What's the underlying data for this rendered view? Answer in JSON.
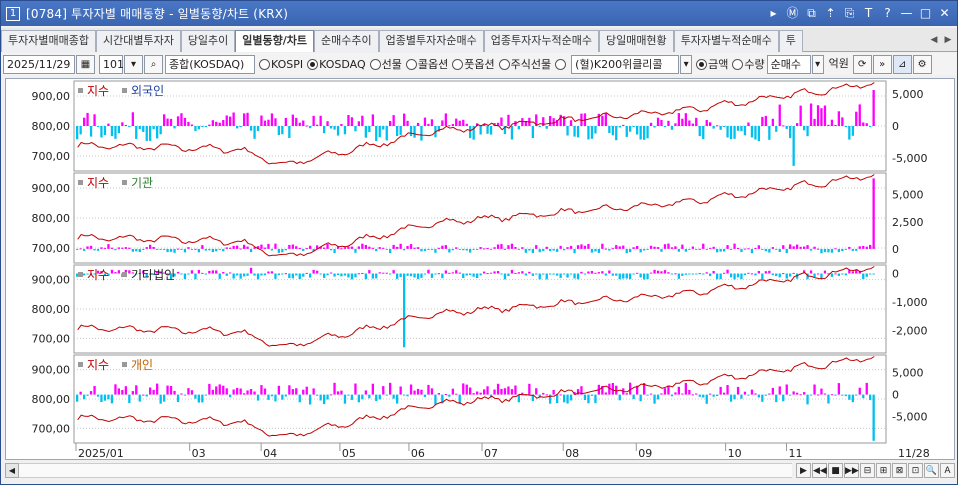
{
  "window": {
    "screen_no": "1",
    "title": "[0784] 투자자별 매매동향 - 일별동향/차트 (KRX)"
  },
  "title_buttons": [
    "▸",
    "Ⓜ",
    "⧉",
    "⇡",
    "⎘",
    "T",
    "?",
    "—",
    "□",
    "✕"
  ],
  "tabs": [
    {
      "label": "투자자별매매종합",
      "active": false
    },
    {
      "label": "시간대별투자자",
      "active": false
    },
    {
      "label": "당일추이",
      "active": false
    },
    {
      "label": "일별동향/차트",
      "active": true
    },
    {
      "label": "순매수추이",
      "active": false
    },
    {
      "label": "업종별투자자순매수",
      "active": false
    },
    {
      "label": "업종투자자누적순매수",
      "active": false
    },
    {
      "label": "당일매매현황",
      "active": false
    },
    {
      "label": "투자자별누적순매수",
      "active": false
    },
    {
      "label": "투",
      "active": false
    }
  ],
  "toolbar": {
    "date": "2025/11/29",
    "code": "101",
    "market_name": "종합(KOSDAQ)",
    "radios": [
      {
        "label": "KOSPI",
        "on": false
      },
      {
        "label": "KOSDAQ",
        "on": true
      },
      {
        "label": "선물",
        "on": false
      },
      {
        "label": "콜옵션",
        "on": false
      },
      {
        "label": "풋옵션",
        "on": false
      },
      {
        "label": "주식선물",
        "on": false
      },
      {
        "label": "",
        "on": false
      }
    ],
    "product_select": "(혈)K200위클리콜",
    "unit_radios": [
      {
        "label": "금액",
        "on": true
      },
      {
        "label": "수량",
        "on": false
      }
    ],
    "mode_select": "순매수",
    "unit_text": "억원"
  },
  "chart_data": [
    {
      "type": "bar",
      "legend": [
        "지수",
        "외국인"
      ],
      "legend_colors": [
        "#c00000",
        "#1f3f9f"
      ],
      "left_ticks": [
        "900,00",
        "800,00",
        "700,00"
      ],
      "right_ticks": [
        "5,000",
        "0",
        "-5,000"
      ],
      "flow_range": [
        -7000,
        7000
      ],
      "flow_ticks": [
        5000,
        0,
        -5000
      ],
      "index_range": [
        650,
        950
      ],
      "index_ticks": [
        900,
        800,
        700
      ]
    },
    {
      "type": "bar",
      "legend": [
        "지수",
        "기관"
      ],
      "legend_colors": [
        "#c00000",
        "#2f7f2f"
      ],
      "left_ticks": [
        "900,00",
        "800,00",
        "700,00"
      ],
      "right_ticks": [
        "5,000",
        "2,500",
        "0"
      ],
      "flow_range": [
        -1300,
        7000
      ],
      "flow_ticks": [
        5000,
        2500,
        0
      ],
      "index_range": [
        650,
        950
      ],
      "index_ticks": [
        900,
        800,
        700
      ]
    },
    {
      "type": "bar",
      "legend": [
        "지수",
        "기타법인"
      ],
      "legend_colors": [
        "#c00000",
        "#222222"
      ],
      "left_ticks": [
        "900,00",
        "800,00",
        "700,00"
      ],
      "right_ticks": [
        "0",
        "-1,000",
        "-2,000"
      ],
      "flow_range": [
        -2800,
        300
      ],
      "flow_ticks": [
        0,
        -1000,
        -2000
      ],
      "index_range": [
        650,
        950
      ],
      "index_ticks": [
        900,
        800,
        700
      ]
    },
    {
      "type": "bar",
      "legend": [
        "지수",
        "개인"
      ],
      "legend_colors": [
        "#c00000",
        "#c06000"
      ],
      "left_ticks": [
        "900,00",
        "800,00",
        "700,00"
      ],
      "right_ticks": [
        "5,000",
        "0",
        "-5,000"
      ],
      "flow_range": [
        -11000,
        9000
      ],
      "flow_ticks": [
        5000,
        0,
        -5000
      ],
      "index_range": [
        650,
        950
      ],
      "index_ticks": [
        900,
        800,
        700
      ]
    }
  ],
  "x_axis": {
    "labels": [
      "2025/01",
      "03",
      "04",
      "05",
      "06",
      "07",
      "08",
      "09",
      "10",
      "11"
    ],
    "end_label": "11/28"
  },
  "colors": {
    "positive_bar": "#ff00ff",
    "negative_bar": "#00c0f0",
    "index_line": "#c00000",
    "grid": "#c8c8c8"
  },
  "scrollbar": {
    "nav_buttons": [
      "▶",
      "◀◀",
      "■",
      "▶▶",
      "⊟",
      "⊞",
      "⊠",
      "⊡",
      "🔍",
      "A"
    ]
  }
}
